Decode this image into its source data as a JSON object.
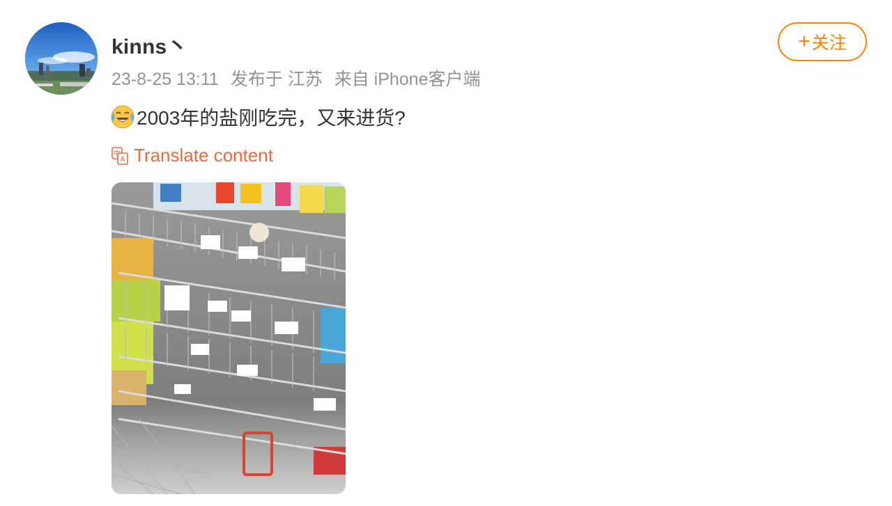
{
  "user": {
    "name": "kinns丶",
    "follow_label": "关注"
  },
  "meta": {
    "time": "23-8-25 13:11",
    "location": "发布于 江苏",
    "source": "来自 iPhone客户端"
  },
  "post": {
    "text": "2003年的盐刚吃完，又来进货?",
    "emoji": "laugh-cry-emoji",
    "translate_label": "Translate content"
  },
  "colors": {
    "accent": "#ff8200",
    "link": "#e86a3f",
    "meta": "#939393",
    "text": "#333333"
  }
}
